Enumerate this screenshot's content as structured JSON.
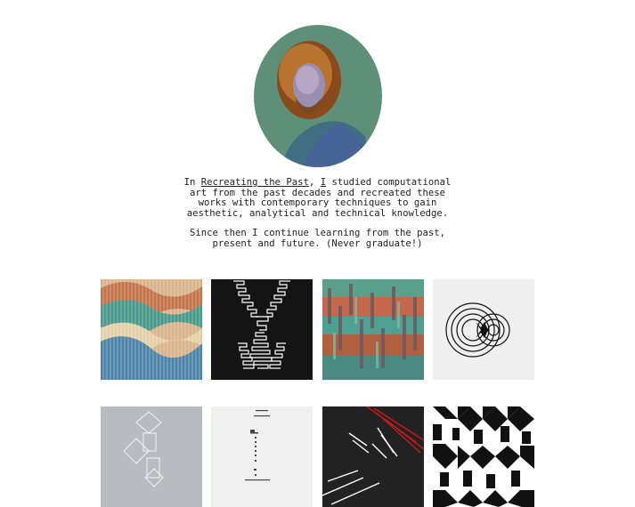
{
  "intro": {
    "prefix": "In ",
    "link_text": "Recreating the Past",
    "middle": ", ",
    "link2_text": "I",
    "suffix": " studied computational art from the past decades and recreated these works with contemporary techniques to gain aesthetic, analytical and technical knowledge.",
    "paragraph2": "Since then I continue learning from the past, present and future. (Never graduate!)"
  },
  "gallery": {
    "items": [
      {
        "name": "wavy-stripes-artwork"
      },
      {
        "name": "double-helix-artwork"
      },
      {
        "name": "colored-columns-artwork"
      },
      {
        "name": "concentric-circles-artwork"
      },
      {
        "name": "cube-outline-artwork"
      },
      {
        "name": "dotted-text-artwork"
      },
      {
        "name": "red-white-lines-artwork"
      },
      {
        "name": "black-white-geometric-artwork"
      }
    ]
  },
  "colors": {
    "portrait_bg": "#5e8f78",
    "text": "#222222"
  }
}
